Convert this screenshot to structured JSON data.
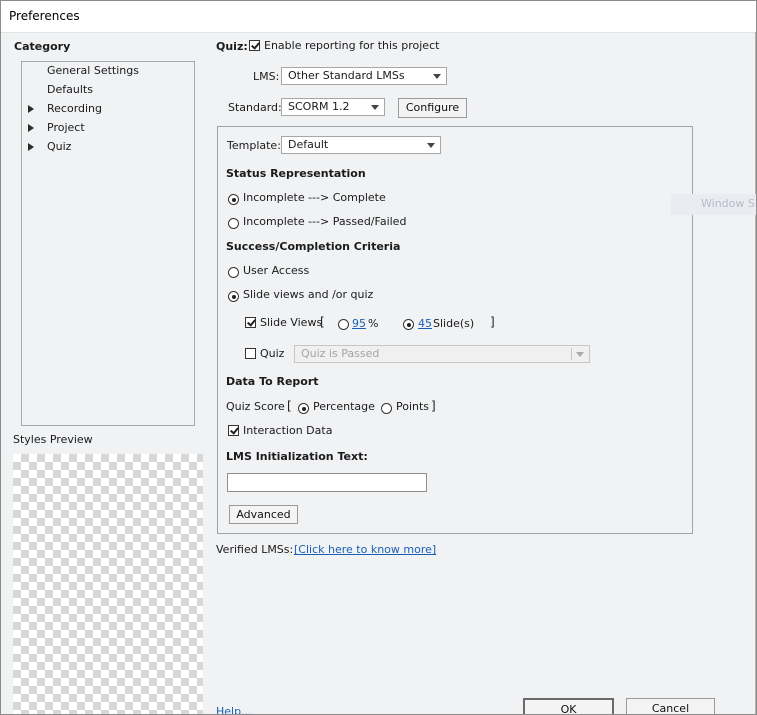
{
  "window": {
    "title": "Preferences"
  },
  "sidebar": {
    "category_label": "Category",
    "items": [
      {
        "label": "General Settings",
        "expandable": false
      },
      {
        "label": "Defaults",
        "expandable": false
      },
      {
        "label": "Recording",
        "expandable": true
      },
      {
        "label": "Project",
        "expandable": true
      },
      {
        "label": "Quiz",
        "expandable": true
      }
    ],
    "styles_preview_label": "Styles Preview"
  },
  "reporting": {
    "section_label": "Quiz:",
    "enable_label": "Enable reporting for this project",
    "enable_checked": true,
    "lms_label": "LMS:",
    "lms_value": "Other Standard LMSs",
    "standard_label": "Standard:",
    "standard_value": "SCORM 1.2",
    "configure_label": "Configure"
  },
  "group": {
    "template_label": "Template:",
    "template_value": "Default",
    "status_heading": "Status Representation",
    "status_options": [
      {
        "label": "Incomplete ---> Complete",
        "selected": true
      },
      {
        "label": "Incomplete ---> Passed/Failed",
        "selected": false
      }
    ],
    "criteria_heading": "Success/Completion Criteria",
    "criteria_options": [
      {
        "label": "User Access",
        "selected": false
      },
      {
        "label": "Slide views and /or quiz",
        "selected": true
      }
    ],
    "slide_views": {
      "label": "Slide Views",
      "checked": true,
      "open_bracket": "[",
      "close_bracket": "]",
      "percent_value": "95",
      "percent_unit": "%",
      "percent_selected": false,
      "slides_value": "45",
      "slides_unit": "Slide(s)",
      "slides_selected": true
    },
    "quiz": {
      "label": "Quiz",
      "checked": false,
      "value": "Quiz is Passed"
    },
    "data_heading": "Data To Report",
    "quiz_score_label": "Quiz Score",
    "score_open": "[",
    "score_close": "]",
    "score_options": [
      {
        "label": "Percentage",
        "selected": true
      },
      {
        "label": "Points",
        "selected": false
      }
    ],
    "interaction_label": "Interaction Data",
    "interaction_checked": true,
    "lms_init_heading": "LMS Initialization Text:",
    "lms_init_value": "",
    "advanced_label": "Advanced"
  },
  "verified": {
    "label": "Verified LMSs:",
    "link": "[Click here to know more]"
  },
  "background_ghost": "Window S",
  "footer": {
    "help_label": "Help...",
    "ok_label": "OK",
    "cancel_label": "Cancel"
  }
}
